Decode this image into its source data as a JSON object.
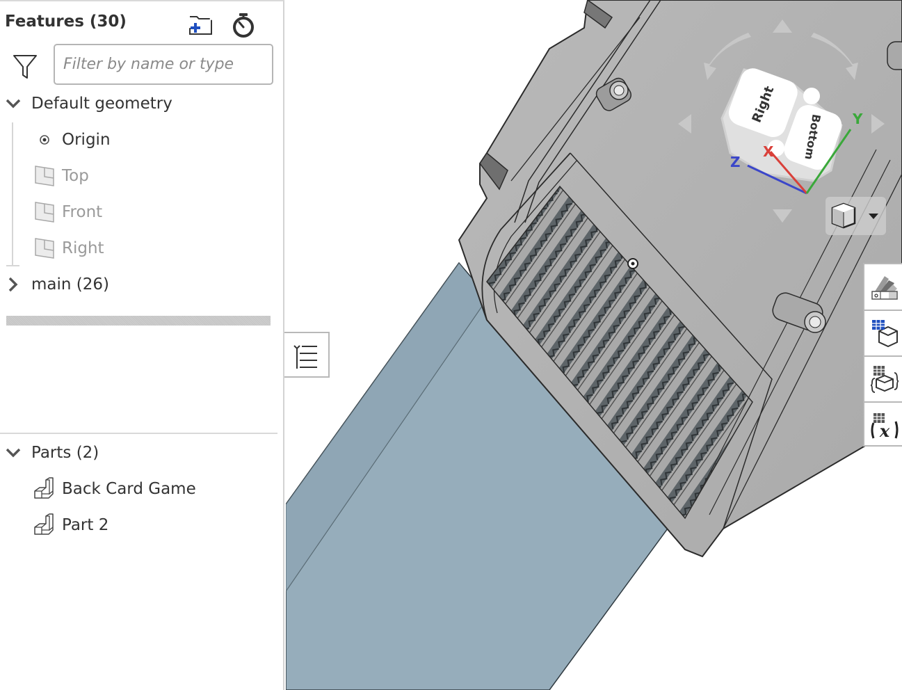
{
  "feature_panel": {
    "title": "Features (30)",
    "add_folder_icon": "folder-plus-icon",
    "rollback_timer_icon": "stopwatch-icon",
    "filter": {
      "icon": "funnel-icon",
      "value": "",
      "placeholder": "Filter by name or type"
    },
    "default_geometry": {
      "label": "Default geometry",
      "expanded": true,
      "items": [
        {
          "label": "Origin",
          "icon": "origin-point-icon",
          "dimmed": false
        },
        {
          "label": "Top",
          "icon": "plane-icon",
          "dimmed": true
        },
        {
          "label": "Front",
          "icon": "plane-icon",
          "dimmed": true
        },
        {
          "label": "Right",
          "icon": "plane-icon",
          "dimmed": true
        }
      ]
    },
    "main_folder": {
      "label": "main (26)",
      "expanded": false
    },
    "rollback_bar": "rollback-bar"
  },
  "parts_panel": {
    "label": "Parts (2)",
    "expanded": true,
    "items": [
      {
        "label": "Back Card Game",
        "icon": "part-icon"
      },
      {
        "label": "Part 2",
        "icon": "part-icon"
      }
    ]
  },
  "collapse_tab": {
    "icon": "feature-list-toggle-icon"
  },
  "view_cube": {
    "faces": {
      "front_face": "Right",
      "side_face": "Bottom"
    },
    "axes": {
      "x": "X",
      "y": "Y",
      "z": "Z"
    },
    "colors": {
      "x": "#d9403a",
      "y": "#3aa83a",
      "z": "#3b46c9"
    },
    "view_options_icon": "view-cube-menu-icon"
  },
  "right_toolbar": [
    {
      "name": "appearances-button",
      "icon": "color-swatch-icon"
    },
    {
      "name": "configurations-button",
      "icon": "configuration-table-icon"
    },
    {
      "name": "custom-properties-button",
      "icon": "variable-table-icon"
    },
    {
      "name": "variables-button",
      "icon": "function-table-icon"
    }
  ],
  "colors": {
    "model_gray": "#b3b3b3",
    "part_blue": "#96adbb",
    "selection_blue": "#1f4fbf"
  }
}
